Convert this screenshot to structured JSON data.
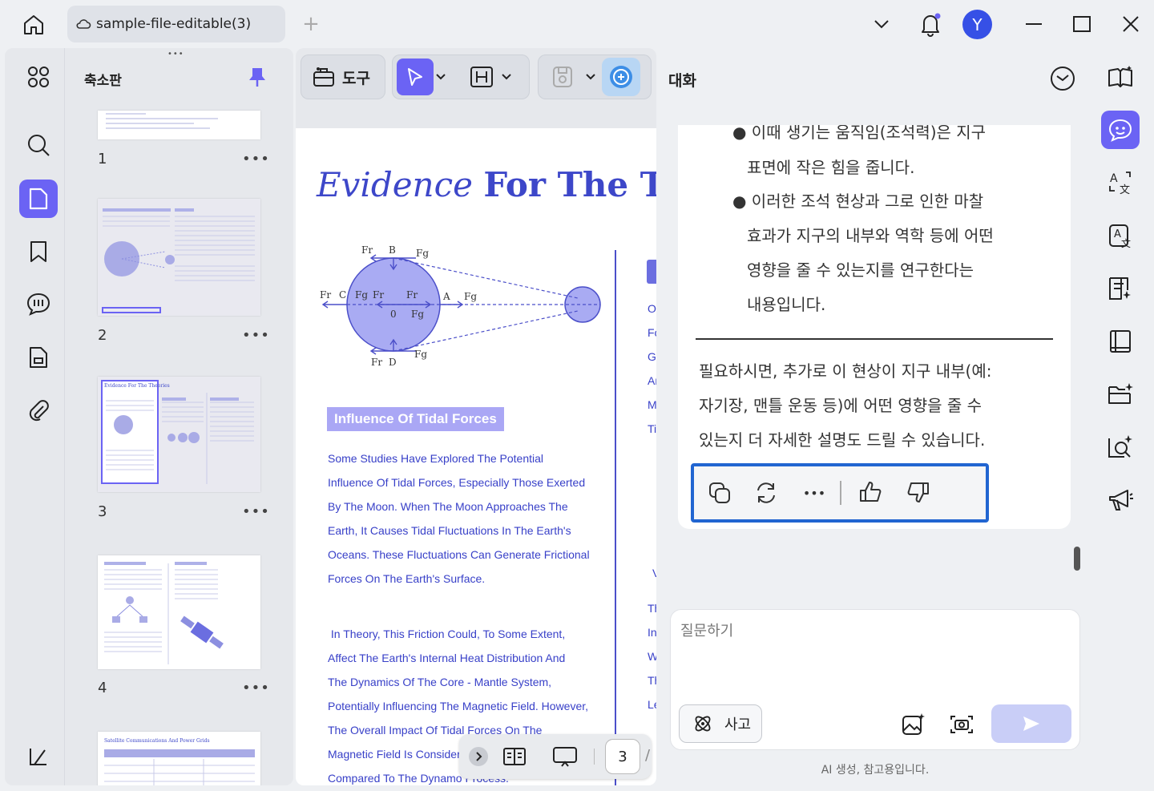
{
  "tab": {
    "title": "sample-file-editable(3)",
    "add": "+"
  },
  "avatar": {
    "initial": "Y"
  },
  "thumbnails": {
    "title": "축소판",
    "drag_handle": "•••",
    "pages": [
      {
        "num": "1",
        "more": "•••"
      },
      {
        "num": "2",
        "more": "•••"
      },
      {
        "num": "3",
        "more": "•••"
      },
      {
        "num": "4",
        "more": "•••"
      }
    ],
    "page3_title": "Evidence For The Theories",
    "page5_title": "Satellite Communications And Power Grids"
  },
  "toolbar": {
    "tools_label": "도구"
  },
  "document": {
    "title_italic": "Evidence",
    "title_bold": "For The Theories",
    "section_heading": "Influence Of Tidal Forces",
    "para1": [
      "Some Studies Have Explored The Potential",
      "Influence Of Tidal Forces, Especially Those Exerted",
      "By The Moon. When The Moon Approaches The",
      "Earth, It Causes Tidal Fluctuations In The Earth's",
      "Oceans. These Fluctuations Can Generate Frictional",
      "Forces On The Earth's Surface."
    ],
    "para2": [
      " In Theory, This Friction Could, To Some Extent,",
      "Affect The Earth's Internal Heat Distribution And",
      "The Dynamics Of The Core - Mantle System,",
      "Potentially Influencing The Magnetic Field. However,",
      "The Overall Impact Of Tidal Forces On The",
      "Magnetic Field Is Considered",
      "Compared To The Dynamo Process."
    ],
    "right_col_letters": [
      "O",
      "Fo",
      "G",
      "Ar",
      "M",
      "Ti",
      "V",
      "Th",
      "In",
      "W",
      "Th",
      "Le"
    ],
    "diagram_labels": {
      "top": "B",
      "left": "C",
      "right": "A",
      "bottom": "D",
      "center": "0",
      "fr": "Fr",
      "fg": "Fg"
    }
  },
  "page_nav": {
    "current": "3",
    "sep": "/"
  },
  "chat": {
    "title": "대화",
    "bullets_1": [
      "● 이때 생기는 움직임(조석력)은 지구",
      "표면에 작은 힘을 줍니다."
    ],
    "bullets_2": [
      "● 이러한 조석 현상과 그로 인한 마찰",
      "효과가 지구의 내부와 역학 등에 어떤",
      "영향을 줄 수 있는지를 연구한다는",
      "내용입니다."
    ],
    "followup": [
      "필요하시면, 추가로 이 현상이 지구 내부(예:",
      "자기장, 맨틀 운동 등)에 어떤 영향을 줄 수",
      "있는지 더 자세한 설명도 드릴 수 있습니다."
    ],
    "more_label": "•••",
    "input_placeholder": "질문하기",
    "think_label": "사고",
    "disclaimer": "AI 생성, 참고용입니다."
  },
  "colors": {
    "accent": "#6b63f4",
    "doc_blue": "#3d47c9",
    "highlight": "#2165d1"
  }
}
